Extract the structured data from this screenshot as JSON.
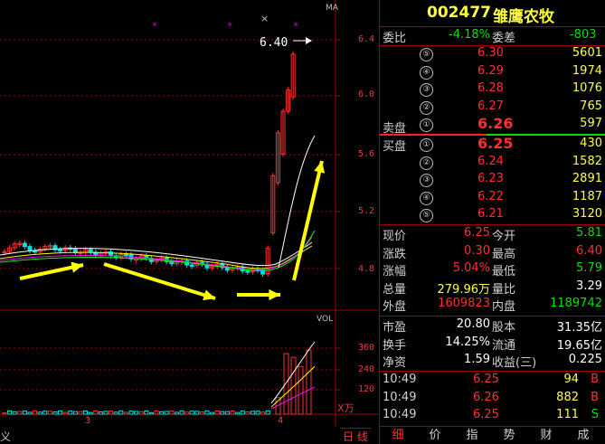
{
  "header": {
    "code": "002477",
    "name": "雏鹰农牧"
  },
  "chart": {
    "ma_label": "MA",
    "high_marker": "6.40",
    "price_axis": [
      "6.4",
      "6.0",
      "5.6",
      "5.2",
      "4.8"
    ],
    "vol_label": "VOL",
    "vol_axis": [
      "360",
      "240",
      "120"
    ],
    "vol_unit": "X万",
    "x_ticks": [
      "3",
      "4"
    ],
    "left_edge_label": "义",
    "period_tab": "日 线",
    "star_marks": [
      "*",
      "*",
      "*"
    ],
    "x_mark": "×"
  },
  "quote": {
    "weibi_label": "委比",
    "weibi_value": "-4.18%",
    "weicha_label": "委差",
    "weicha_value": "-803",
    "sell_label": "卖盘",
    "buy_label": "买盘",
    "asks": [
      {
        "level": "⑤",
        "price": "6.30",
        "volume": "5601"
      },
      {
        "level": "④",
        "price": "6.29",
        "volume": "1974"
      },
      {
        "level": "③",
        "price": "6.28",
        "volume": "1076"
      },
      {
        "level": "②",
        "price": "6.27",
        "volume": "765"
      },
      {
        "level": "①",
        "price": "6.26",
        "volume": "597"
      }
    ],
    "bids": [
      {
        "level": "①",
        "price": "6.25",
        "volume": "430"
      },
      {
        "level": "②",
        "price": "6.24",
        "volume": "1582"
      },
      {
        "level": "③",
        "price": "6.23",
        "volume": "2891"
      },
      {
        "level": "④",
        "price": "6.22",
        "volume": "1187"
      },
      {
        "level": "⑤",
        "price": "6.21",
        "volume": "3120"
      }
    ],
    "stats": [
      {
        "l1": "现价",
        "v1": "6.25",
        "c1": "red",
        "l2": "今开",
        "v2": "5.81",
        "c2": "green"
      },
      {
        "l1": "涨跌",
        "v1": "0.30",
        "c1": "red",
        "l2": "最高",
        "v2": "6.40",
        "c2": "red"
      },
      {
        "l1": "涨幅",
        "v1": "5.04%",
        "c1": "red",
        "l2": "最低",
        "v2": "5.79",
        "c2": "green"
      },
      {
        "l1": "总量",
        "v1": "279.96万",
        "c1": "yellow",
        "l2": "量比",
        "v2": "3.29",
        "c2": "white"
      },
      {
        "l1": "外盘",
        "v1": "1609823",
        "c1": "red",
        "l2": "内盘",
        "v2": "1189742",
        "c2": "green"
      }
    ],
    "fundamentals": [
      {
        "l1": "市盈",
        "v1": "20.80",
        "l2": "股本",
        "v2": "31.35亿"
      },
      {
        "l1": "换手",
        "v1": "14.25%",
        "l2": "流通",
        "v2": "19.65亿"
      },
      {
        "l1": "净资",
        "v1": "1.59",
        "l2": "收益(三)",
        "v2": "0.225"
      }
    ],
    "ticks": [
      {
        "time": "10:49",
        "price": "6.25",
        "volume": "94",
        "side": "B",
        "side_color": "red"
      },
      {
        "time": "10:49",
        "price": "6.26",
        "volume": "882",
        "side": "B",
        "side_color": "red"
      },
      {
        "time": "10:49",
        "price": "6.25",
        "volume": "111",
        "side": "S",
        "side_color": "green"
      }
    ],
    "tabs": [
      "细",
      "价",
      "指",
      "势",
      "财",
      "成"
    ]
  },
  "colors": {
    "up": "#ff3030",
    "down": "#00e0e0",
    "grid": "#a00000",
    "arrow": "#ffff00"
  }
}
